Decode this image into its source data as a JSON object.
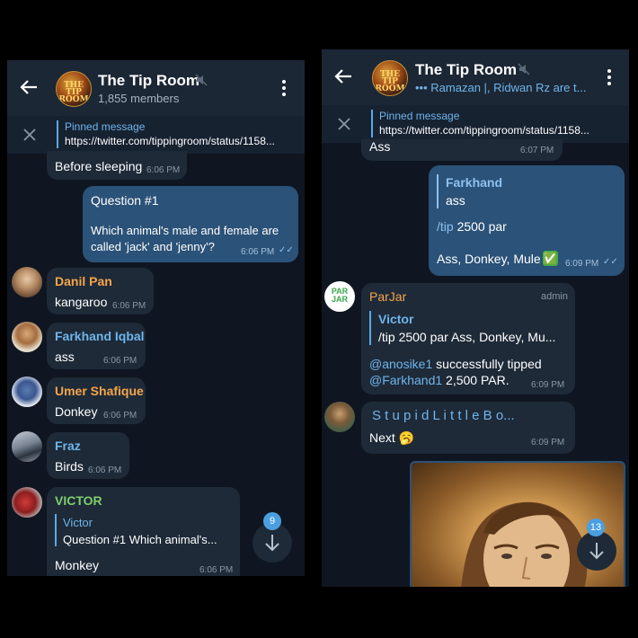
{
  "left": {
    "header": {
      "title": "The Tip Room",
      "subtitle": "1,855 members",
      "logo_text": "THE TIP ROOM"
    },
    "pinned": {
      "title": "Pinned message",
      "text": "https://twitter.com/tippingroom/status/1158..."
    },
    "messages": [
      {
        "text": "Before sleeping",
        "time": "6:06 PM"
      },
      {
        "title": "Question #1",
        "body_line1": "Which animal's male and female are",
        "body_line2": "called 'jack' and 'jenny'?",
        "time": "6:06 PM"
      },
      {
        "sender": "Danil Pan",
        "text": "kangaroo",
        "time": "6:06 PM",
        "color": "#f5a54a"
      },
      {
        "sender": "Farkhand Iqbal",
        "text": "ass",
        "time": "6:06 PM",
        "color": "#6fb5ec"
      },
      {
        "sender": "Umer Shafique",
        "text": "Donkey",
        "time": "6:06 PM",
        "color": "#f5a54a"
      },
      {
        "sender": "Fraz",
        "text": "Birds",
        "time": "6:06 PM",
        "color": "#6fb5ec"
      },
      {
        "sender": "VICTOR",
        "reply_name": "Victor",
        "reply_text": "Question #1  Which animal's...",
        "text": "Monkey",
        "time": "6:06 PM",
        "color": "#7fcf6b"
      }
    ],
    "unread_badge": "9"
  },
  "right": {
    "header": {
      "title": "The Tip Room",
      "subtitle": "Ramazan |, Ridwan Rz are t...",
      "typing_dots": "•••",
      "logo_text": "THE TIP ROOM"
    },
    "pinned": {
      "title": "Pinned message",
      "text": "https://twitter.com/tippingroom/status/1158..."
    },
    "messages": [
      {
        "text": "Ass",
        "time": "6:07 PM"
      },
      {
        "reply_name": "Farkhand",
        "reply_text": "ass",
        "cmd": "/tip",
        "cmd_rest": " 2500 par",
        "text": "Ass, Donkey, Mule",
        "check": "✅",
        "time": "6:09 PM"
      },
      {
        "sender": "ParJar",
        "role": "admin",
        "reply_name": "Victor",
        "reply_text": "/tip 2500 par  Ass, Donkey, Mu...",
        "mention1": "@anosike1",
        "line1_rest": " successfully tipped",
        "mention2": "@Farkhand1",
        "line2_rest": " 2,500 PAR.",
        "time": "6:09 PM",
        "avatar_text": "PAR JAR"
      },
      {
        "sender": "S t u p i d  L i t t l e  B o...",
        "text": "Next",
        "emoji": "🥱",
        "time": "6:09 PM"
      }
    ],
    "unread_badge": "13"
  },
  "colors": {
    "accent": "#5aa9e6",
    "outgoing_bubble": "#2b5278",
    "incoming_bubble": "#1e2a38",
    "background": "#0f1621",
    "header": "#1c2735"
  }
}
